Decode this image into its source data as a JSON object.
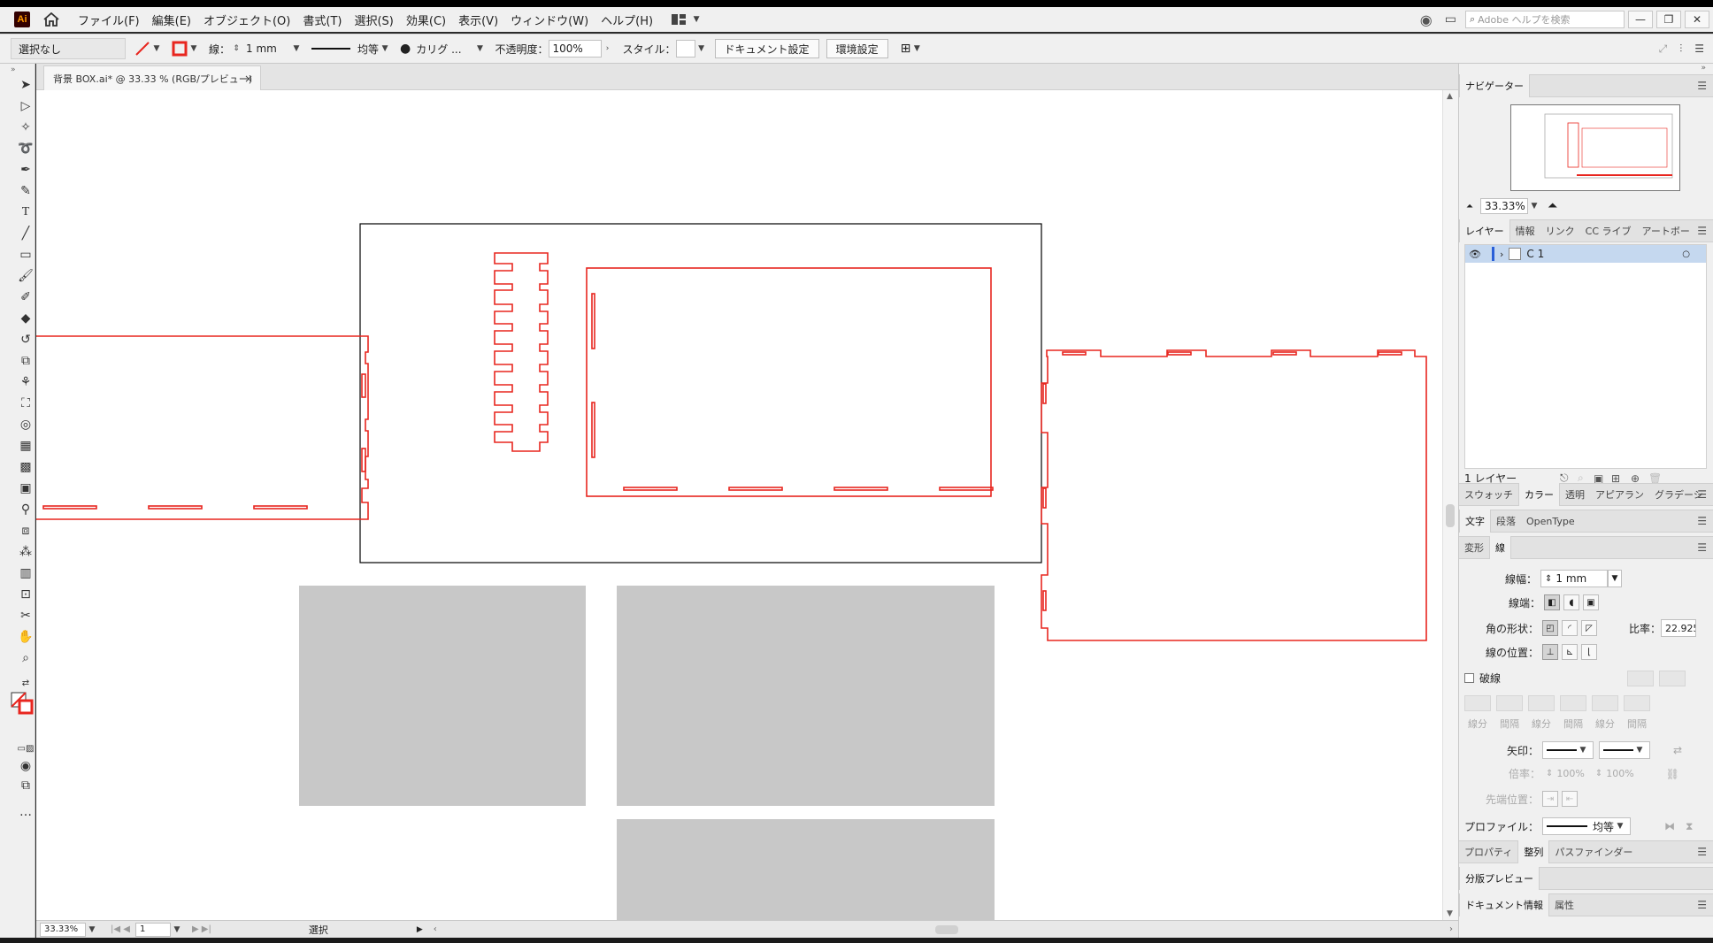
{
  "app": {
    "logo": "Ai"
  },
  "menu": [
    "ファイル(F)",
    "編集(E)",
    "オブジェクト(O)",
    "書式(T)",
    "選択(S)",
    "効果(C)",
    "表示(V)",
    "ウィンドウ(W)",
    "ヘルプ(H)"
  ],
  "help_search": {
    "placeholder": "Adobe ヘルプを検索"
  },
  "control": {
    "selection": "選択なし",
    "stroke_label": "線：",
    "stroke_value": "1 mm",
    "profile": "均等",
    "brush": "カリグ ...",
    "opacity_label": "不透明度：",
    "opacity_value": "100%",
    "style_label": "スタイル：",
    "doc_setup": "ドキュメント設定",
    "prefs": "環境設定"
  },
  "document_tab": {
    "title": "背景 BOX.ai* @ 33.33 % (RGB/プレビュー)",
    "close": "×"
  },
  "status": {
    "zoom": "33.33%",
    "artboard": "1",
    "tool": "選択"
  },
  "navigator": {
    "tab": "ナビゲーター",
    "zoom": "33.33%"
  },
  "layers_tabs": [
    "レイヤー",
    "情報",
    "リンク",
    "CC ライブ",
    "アートボー"
  ],
  "layer": {
    "name": "C 1"
  },
  "layers_footer": "1 レイヤー",
  "color_tabs": [
    "スウォッチ",
    "カラー",
    "透明",
    "アピアラン",
    "グラデーシ"
  ],
  "char_tabs": [
    "文字",
    "段落",
    "OpenType"
  ],
  "stroke_tabs": [
    "変形",
    "線"
  ],
  "stroke_panel": {
    "weight_label": "線幅：",
    "weight_value": "1 mm",
    "cap_label": "線端：",
    "corner_label": "角の形状：",
    "ratio_label": "比率：",
    "ratio_value": "22.925",
    "align_label": "線の位置：",
    "dashed_label": "破線",
    "dash_labels": [
      "線分",
      "間隔",
      "線分",
      "間隔",
      "線分",
      "間隔"
    ],
    "arrow_label": "矢印：",
    "scale_label": "倍率：",
    "scale_value1": "100%",
    "scale_value2": "100%",
    "tip_label": "先端位置：",
    "profile_label": "プロファイル：",
    "profile_value": "均等"
  },
  "bottom_tabs1": [
    "プロパティ",
    "整列",
    "パスファインダー"
  ],
  "bottom_tab2": "分版プレビュー",
  "bottom_tabs3": [
    "ドキュメント情報",
    "属性"
  ],
  "colors": {
    "cut_line": "#e8261f",
    "gray_box": "#c8c8c8",
    "artboard_border": "#000000"
  }
}
